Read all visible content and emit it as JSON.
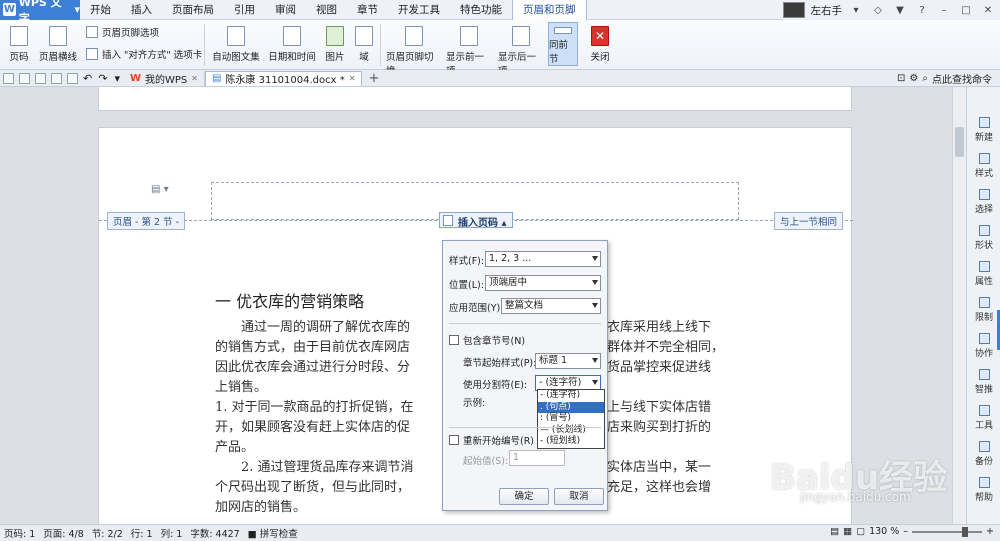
{
  "app": {
    "title": "WPS 文字"
  },
  "menu_tabs": [
    "开始",
    "插入",
    "页面布局",
    "引用",
    "审阅",
    "视图",
    "章节",
    "开发工具",
    "特色功能",
    "页眉和页脚"
  ],
  "user": {
    "name": "左右手"
  },
  "ribbon": {
    "page_number": "页码",
    "header_line": "页眉横线",
    "header_footer_options": "页眉页脚选项",
    "insert_align_tab": "插入 \"对齐方式\" 选项卡",
    "autotext": "自动图文集",
    "date_time": "日期和时间",
    "picture": "图片",
    "field": "域",
    "switch_hf": "页眉页脚切换",
    "show_prev": "显示前一项",
    "show_next": "显示后一项",
    "same_as_prev": "同前节",
    "close": "关闭"
  },
  "tabs": {
    "my_wps": "我的WPS",
    "doc": "陈永康 31101004.docx *",
    "help": "点此查找命令"
  },
  "header_labels": {
    "header": "页眉 - 第 2 节 -",
    "same": "与上一节相同",
    "insert_page_number": "插入页码"
  },
  "document": {
    "heading": "一 优衣库的营销策略",
    "lines": [
      "通过一周的调研了解优衣库的",
      "衣库采用线上线下",
      "的销售方式，由于目前优衣库网店",
      "群体并不完全相同，",
      "因此优衣库会通过进行分时段、分",
      "货品掌控来促进线",
      "上销售。",
      "1. 对于同一款商品的打折促销，在",
      "上与线下实体店错",
      "开，如果顾客没有赶上实体店的促",
      "店来购买到打折的",
      "产品。",
      "2. 通过管理货品库存来调节消",
      "实体店当中，某一",
      "个尺码出现了断货，但与此同时，",
      "充足，这样也会增",
      "加网店的销售。"
    ]
  },
  "dialog": {
    "style_label": "样式(F):",
    "style_value": "1, 2, 3 ...",
    "position_label": "位置(L):",
    "position_value": "顶端居中",
    "scope_label": "应用范围(Y):",
    "scope_value": "整篇文档",
    "include_chapter": "包含章节号(N)",
    "chapter_style_label": "章节起始样式(P):",
    "chapter_style_value": "标题 1",
    "separator_label": "使用分割符(E):",
    "separator_value": "-  (连字符)",
    "example_label": "示例:",
    "separator_options": [
      "-  (连字符)",
      ".  (句点)",
      ":  (冒号)",
      "—  (长划线)",
      "-  (短划线)"
    ],
    "restart": "重新开始编号(R)",
    "start_label": "起始值(S):",
    "start_value": "1",
    "ok": "确定",
    "cancel": "取消"
  },
  "right_panel": [
    "新建",
    "样式",
    "选择",
    "形状",
    "属性",
    "限制",
    "协作",
    "智推",
    "工具",
    "备份",
    "帮助"
  ],
  "status": {
    "page_number": "页码: 1",
    "pages": "页面: 4/8",
    "section": "节: 2/2",
    "row": "行: 1",
    "col": "列: 1",
    "words": "字数: 4427",
    "spell": "拼写检查",
    "zoom": "130 %"
  },
  "watermark": {
    "main": "Baidu经验",
    "sub": "jingyan.baidu.com"
  }
}
